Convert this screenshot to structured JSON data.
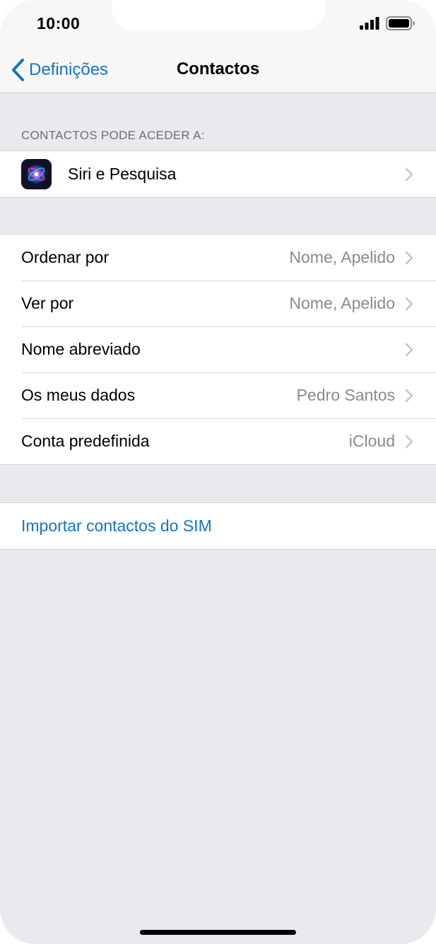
{
  "status_bar": {
    "time": "10:00",
    "signal_icon": "cellular-signal-icon",
    "battery_icon": "battery-full-icon"
  },
  "nav": {
    "back_label": "Definições",
    "back_icon": "chevron-left-icon",
    "title": "Contactos"
  },
  "access_section": {
    "header": "CONTACTOS PODE ACEDER A:",
    "items": [
      {
        "label": "Siri e Pesquisa",
        "icon": "siri-icon"
      }
    ]
  },
  "settings": {
    "items": [
      {
        "label": "Ordenar por",
        "value": "Nome, Apelido"
      },
      {
        "label": "Ver por",
        "value": "Nome, Apelido"
      },
      {
        "label": "Nome abreviado",
        "value": ""
      },
      {
        "label": "Os meus dados",
        "value": "Pedro Santos"
      },
      {
        "label": "Conta predefinida",
        "value": "iCloud"
      }
    ]
  },
  "import": {
    "label": "Importar contactos do SIM"
  },
  "colors": {
    "accent": "#1474c8",
    "background": "#e9e9ee",
    "secondary_text": "#8a8a8e",
    "chevron": "#c4c4c7"
  }
}
